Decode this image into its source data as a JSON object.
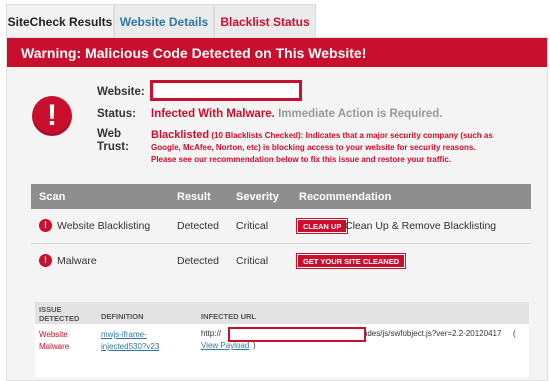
{
  "tabs": [
    {
      "label": "SiteCheck Results"
    },
    {
      "label": "Website Details"
    },
    {
      "label": "Blacklist Status"
    }
  ],
  "banner": {
    "text": "Warning: Malicious Code Detected on This Website!"
  },
  "alert_icon_glyph": "!",
  "info": {
    "website_label": "Website:",
    "status_label": "Status:",
    "webtrust_label": "Web Trust:",
    "status_infected": "Infected With Malware.",
    "status_action": "Immediate Action is Required.",
    "blacklisted_title": "Blacklisted",
    "blacklisted_count": "(10 Blacklists Checked):",
    "blacklisted_desc": "Indicates that a major security company (such as Google, McAfee, Norton, etc) is blocking access to your website for security reasons. Please see our recommendation below to fix this issue and restore your traffic."
  },
  "scan_table": {
    "headers": {
      "scan": "Scan",
      "result": "Result",
      "severity": "Severity",
      "recommendation": "Recommendation"
    },
    "rows": [
      {
        "scan": "Website Blacklisting",
        "result": "Detected",
        "severity": "Critical",
        "button": "CLEAN UP",
        "recommendation": "Clean Up & Remove Blacklisting"
      },
      {
        "scan": "Malware",
        "result": "Detected",
        "severity": "Critical",
        "button": "GET YOUR SITE CLEANED",
        "recommendation": ""
      }
    ]
  },
  "issue_table": {
    "headers": {
      "issue_detected": "ISSUE DETECTED",
      "definition": "DEFINITION",
      "infected_url": "INFECTED URL"
    },
    "row": {
      "issue": "Website Malware",
      "definition": "mwjs-iframe-injected530?v23",
      "url_prefix": "http://",
      "url_suffix": "wp-includes/js/swfobject.js?ver=2.2-20120417",
      "paren_open": "(",
      "view_payload": "View Payload",
      "paren_close": ")"
    }
  },
  "colors": {
    "accent_red": "#c8102e",
    "link_blue": "#2f7a9c",
    "header_gray": "#8e8e8e"
  }
}
